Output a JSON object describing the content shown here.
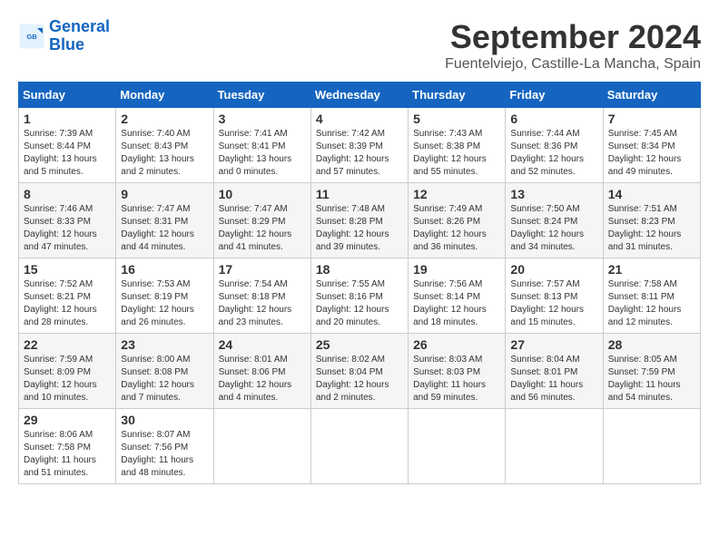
{
  "logo": {
    "line1": "General",
    "line2": "Blue"
  },
  "title": "September 2024",
  "subtitle": "Fuentelviejo, Castille-La Mancha, Spain",
  "headers": [
    "Sunday",
    "Monday",
    "Tuesday",
    "Wednesday",
    "Thursday",
    "Friday",
    "Saturday"
  ],
  "weeks": [
    [
      {
        "day": "1",
        "info": "Sunrise: 7:39 AM\nSunset: 8:44 PM\nDaylight: 13 hours\nand 5 minutes."
      },
      {
        "day": "2",
        "info": "Sunrise: 7:40 AM\nSunset: 8:43 PM\nDaylight: 13 hours\nand 2 minutes."
      },
      {
        "day": "3",
        "info": "Sunrise: 7:41 AM\nSunset: 8:41 PM\nDaylight: 13 hours\nand 0 minutes."
      },
      {
        "day": "4",
        "info": "Sunrise: 7:42 AM\nSunset: 8:39 PM\nDaylight: 12 hours\nand 57 minutes."
      },
      {
        "day": "5",
        "info": "Sunrise: 7:43 AM\nSunset: 8:38 PM\nDaylight: 12 hours\nand 55 minutes."
      },
      {
        "day": "6",
        "info": "Sunrise: 7:44 AM\nSunset: 8:36 PM\nDaylight: 12 hours\nand 52 minutes."
      },
      {
        "day": "7",
        "info": "Sunrise: 7:45 AM\nSunset: 8:34 PM\nDaylight: 12 hours\nand 49 minutes."
      }
    ],
    [
      {
        "day": "8",
        "info": "Sunrise: 7:46 AM\nSunset: 8:33 PM\nDaylight: 12 hours\nand 47 minutes."
      },
      {
        "day": "9",
        "info": "Sunrise: 7:47 AM\nSunset: 8:31 PM\nDaylight: 12 hours\nand 44 minutes."
      },
      {
        "day": "10",
        "info": "Sunrise: 7:47 AM\nSunset: 8:29 PM\nDaylight: 12 hours\nand 41 minutes."
      },
      {
        "day": "11",
        "info": "Sunrise: 7:48 AM\nSunset: 8:28 PM\nDaylight: 12 hours\nand 39 minutes."
      },
      {
        "day": "12",
        "info": "Sunrise: 7:49 AM\nSunset: 8:26 PM\nDaylight: 12 hours\nand 36 minutes."
      },
      {
        "day": "13",
        "info": "Sunrise: 7:50 AM\nSunset: 8:24 PM\nDaylight: 12 hours\nand 34 minutes."
      },
      {
        "day": "14",
        "info": "Sunrise: 7:51 AM\nSunset: 8:23 PM\nDaylight: 12 hours\nand 31 minutes."
      }
    ],
    [
      {
        "day": "15",
        "info": "Sunrise: 7:52 AM\nSunset: 8:21 PM\nDaylight: 12 hours\nand 28 minutes."
      },
      {
        "day": "16",
        "info": "Sunrise: 7:53 AM\nSunset: 8:19 PM\nDaylight: 12 hours\nand 26 minutes."
      },
      {
        "day": "17",
        "info": "Sunrise: 7:54 AM\nSunset: 8:18 PM\nDaylight: 12 hours\nand 23 minutes."
      },
      {
        "day": "18",
        "info": "Sunrise: 7:55 AM\nSunset: 8:16 PM\nDaylight: 12 hours\nand 20 minutes."
      },
      {
        "day": "19",
        "info": "Sunrise: 7:56 AM\nSunset: 8:14 PM\nDaylight: 12 hours\nand 18 minutes."
      },
      {
        "day": "20",
        "info": "Sunrise: 7:57 AM\nSunset: 8:13 PM\nDaylight: 12 hours\nand 15 minutes."
      },
      {
        "day": "21",
        "info": "Sunrise: 7:58 AM\nSunset: 8:11 PM\nDaylight: 12 hours\nand 12 minutes."
      }
    ],
    [
      {
        "day": "22",
        "info": "Sunrise: 7:59 AM\nSunset: 8:09 PM\nDaylight: 12 hours\nand 10 minutes."
      },
      {
        "day": "23",
        "info": "Sunrise: 8:00 AM\nSunset: 8:08 PM\nDaylight: 12 hours\nand 7 minutes."
      },
      {
        "day": "24",
        "info": "Sunrise: 8:01 AM\nSunset: 8:06 PM\nDaylight: 12 hours\nand 4 minutes."
      },
      {
        "day": "25",
        "info": "Sunrise: 8:02 AM\nSunset: 8:04 PM\nDaylight: 12 hours\nand 2 minutes."
      },
      {
        "day": "26",
        "info": "Sunrise: 8:03 AM\nSunset: 8:03 PM\nDaylight: 11 hours\nand 59 minutes."
      },
      {
        "day": "27",
        "info": "Sunrise: 8:04 AM\nSunset: 8:01 PM\nDaylight: 11 hours\nand 56 minutes."
      },
      {
        "day": "28",
        "info": "Sunrise: 8:05 AM\nSunset: 7:59 PM\nDaylight: 11 hours\nand 54 minutes."
      }
    ],
    [
      {
        "day": "29",
        "info": "Sunrise: 8:06 AM\nSunset: 7:58 PM\nDaylight: 11 hours\nand 51 minutes."
      },
      {
        "day": "30",
        "info": "Sunrise: 8:07 AM\nSunset: 7:56 PM\nDaylight: 11 hours\nand 48 minutes."
      },
      {
        "day": "",
        "info": ""
      },
      {
        "day": "",
        "info": ""
      },
      {
        "day": "",
        "info": ""
      },
      {
        "day": "",
        "info": ""
      },
      {
        "day": "",
        "info": ""
      }
    ]
  ]
}
